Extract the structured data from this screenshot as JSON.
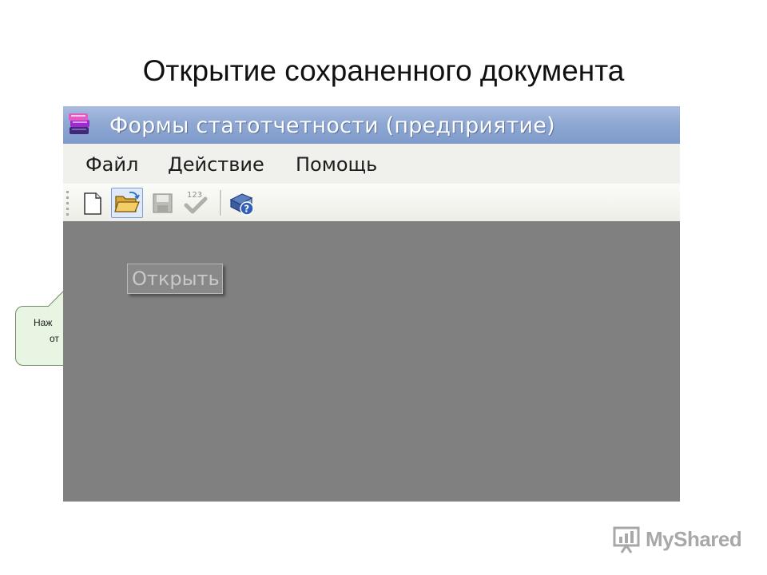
{
  "slide": {
    "title": "Открытие сохраненного документа"
  },
  "callout": {
    "line1": "Наж",
    "line2": "от"
  },
  "window": {
    "title": "Формы статотчетности (предприятие)",
    "icon": "books-app-icon",
    "titlebar_color": "#8fa8d3",
    "workspace_color": "#808080"
  },
  "menu": {
    "items": [
      {
        "label": "Файл"
      },
      {
        "label": "Действие"
      },
      {
        "label": "Помощь"
      }
    ]
  },
  "toolbar": {
    "buttons": [
      {
        "icon": "new-document-icon",
        "state": "normal"
      },
      {
        "icon": "open-folder-icon",
        "state": "hover"
      },
      {
        "icon": "save-disk-icon",
        "state": "disabled"
      },
      {
        "icon": "check-123-icon",
        "state": "disabled",
        "badge": "123"
      },
      {
        "icon": "help-book-icon",
        "state": "normal"
      }
    ]
  },
  "tooltip": {
    "text": "Открыть"
  },
  "watermark": {
    "text": "MyShared"
  }
}
